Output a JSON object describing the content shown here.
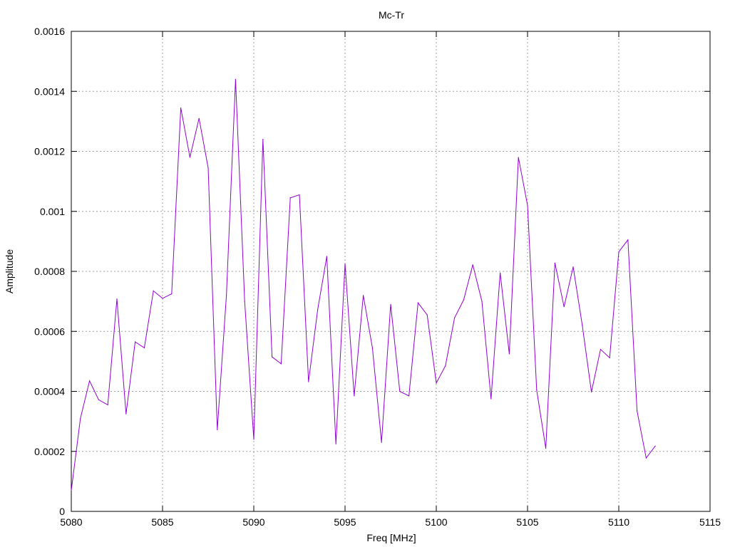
{
  "chart_data": {
    "type": "line",
    "title": "Mc-Tr",
    "xlabel": "Freq [MHz]",
    "ylabel": "Amplitude",
    "xlim": [
      5080,
      5115
    ],
    "ylim": [
      0,
      0.0016
    ],
    "x_ticks": [
      "5080",
      "5085",
      "5090",
      "5095",
      "5100",
      "5105",
      "5110",
      "5115"
    ],
    "y_ticks": [
      "0",
      "0.0002",
      "0.0004",
      "0.0006",
      "0.0008",
      "0.001",
      "0.0012",
      "0.0014",
      "0.0016"
    ],
    "grid": true,
    "line_color": "#9400d3",
    "series": [
      {
        "x": [
          5080,
          5080.5,
          5081,
          5081.5,
          5082,
          5082.5,
          5083,
          5083.5,
          5084,
          5084.5,
          5085,
          5085.5,
          5086,
          5086.5,
          5087,
          5087.5,
          5088,
          5088.5,
          5089,
          5089.5,
          5090,
          5090.5,
          5091,
          5091.5,
          5092,
          5092.5,
          5093,
          5093.5,
          5094,
          5094.5,
          5095,
          5095.5,
          5096,
          5096.5,
          5097,
          5097.5,
          5098,
          5098.5,
          5099,
          5099.5,
          5100,
          5100.5,
          5101,
          5101.5,
          5102,
          5102.5,
          5103,
          5103.5,
          5104,
          5104.5,
          5105,
          5105.5,
          5106,
          5106.5,
          5107,
          5107.5,
          5108,
          5108.5,
          5109,
          5109.5,
          5110,
          5110.5,
          5111,
          5111.5,
          5112
        ],
        "y": [
          7e-05,
          0.00031,
          0.000435,
          0.000372,
          0.000355,
          0.000708,
          0.000325,
          0.000565,
          0.000545,
          0.000735,
          0.00071,
          0.000725,
          0.001345,
          0.00118,
          0.00131,
          0.001145,
          0.000272,
          0.00072,
          0.00144,
          0.0007,
          0.00024,
          0.00124,
          0.000515,
          0.000492,
          0.001045,
          0.001055,
          0.000432,
          0.000672,
          0.00085,
          0.000225,
          0.000825,
          0.000385,
          0.00072,
          0.000545,
          0.00023,
          0.00069,
          0.0004,
          0.000385,
          0.000695,
          0.000655,
          0.000428,
          0.000485,
          0.000645,
          0.000705,
          0.000822,
          0.0007,
          0.000375,
          0.000795,
          0.000525,
          0.00118,
          0.00102,
          0.000405,
          0.00021,
          0.000828,
          0.000682,
          0.000815,
          0.00062,
          0.000398,
          0.00054,
          0.000512,
          0.000865,
          0.000905,
          0.000335,
          0.000178,
          0.000218
        ]
      }
    ]
  }
}
